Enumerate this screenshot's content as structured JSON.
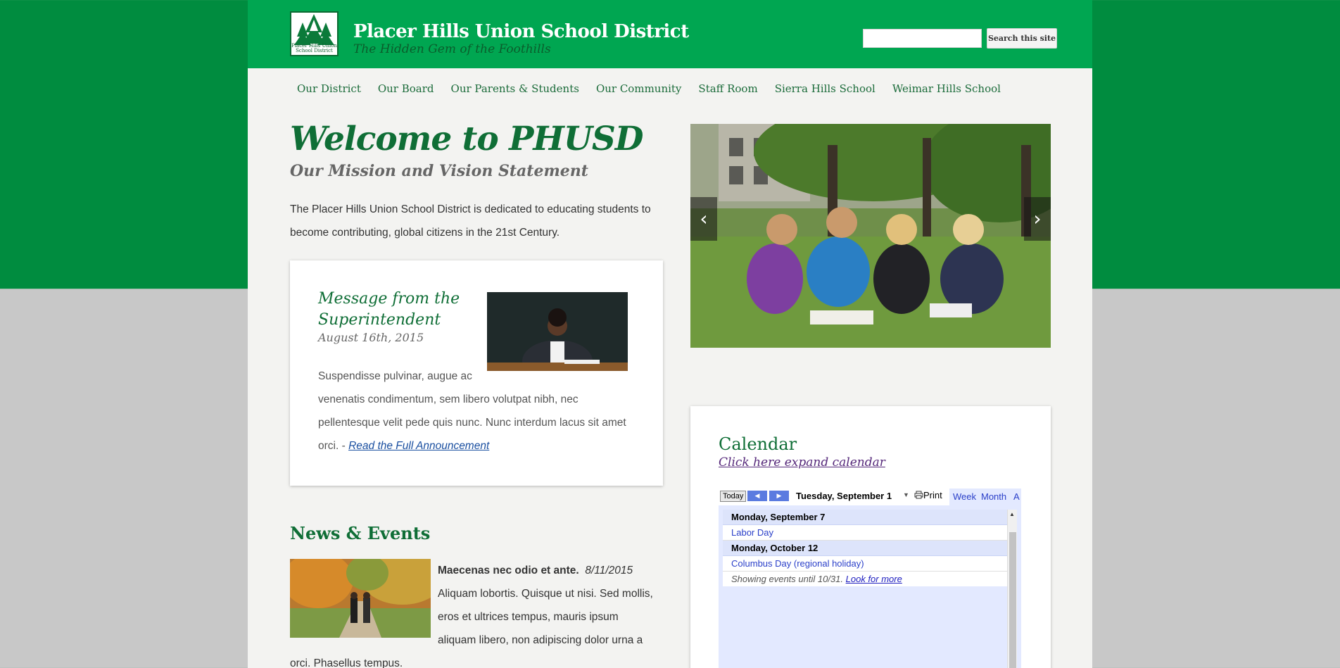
{
  "header": {
    "logo_text": "Placer Hills Union School District",
    "site_title": "Placer Hills Union School District",
    "tagline": "The Hidden Gem of the Foothills",
    "search_placeholder": "",
    "search_button": "Search this site"
  },
  "nav": {
    "items": [
      {
        "label": "Our District"
      },
      {
        "label": "Our Board"
      },
      {
        "label": "Our Parents & Students"
      },
      {
        "label": "Our Community"
      },
      {
        "label": "Staff Room"
      },
      {
        "label": "Sierra Hills School"
      },
      {
        "label": "Weimar Hills School"
      }
    ]
  },
  "hero": {
    "title": "Welcome to PHUSD",
    "subtitle": "Our Mission and Vision Statement",
    "intro": "The Placer Hills Union School District is dedicated to educating students to become contributing, global citizens in the 21st Century."
  },
  "slider": {
    "prev": "‹",
    "next": "›"
  },
  "message": {
    "title": "Message from the Superintendent",
    "date": "August 16th, 2015",
    "body_line1": "Suspendisse pulvinar, augue ac",
    "body_rest": "venenatis condimentum, sem libero volutpat nibh, nec pellentesque velit pede quis nunc. Nunc interdum lacus sit amet orci.",
    "dash": " - ",
    "link": "Read the Full Announcement"
  },
  "news": {
    "heading": "News & Events",
    "items": [
      {
        "title": "Maecenas nec odio et ante.",
        "date": "8/11/2015",
        "body": "Aliquam lobortis. Quisque ut nisi. Sed mollis, eros et ultrices tempus, mauris ipsum aliquam libero, non adipiscing dolor urna a orci. Phasellus tempus."
      }
    ]
  },
  "calendar": {
    "title": "Calendar",
    "expand_link": "Click here expand calendar",
    "toolbar": {
      "today": "Today",
      "prev": "◀",
      "next": "▶",
      "date": "Tuesday, September 1",
      "caret": "▼",
      "print": "Print",
      "tabs": [
        "Week",
        "Month",
        "A"
      ]
    },
    "days": [
      {
        "day": "Monday, September 7",
        "events": [
          "Labor Day"
        ]
      },
      {
        "day": "Monday, October 12",
        "events": [
          "Columbus Day (regional holiday)"
        ]
      }
    ],
    "footer": "Showing events until 10/31.",
    "footer_link": "Look for more"
  },
  "colors": {
    "brand_green": "#00a651",
    "dark_green": "#008c3f",
    "text_green": "#0f6e36"
  }
}
